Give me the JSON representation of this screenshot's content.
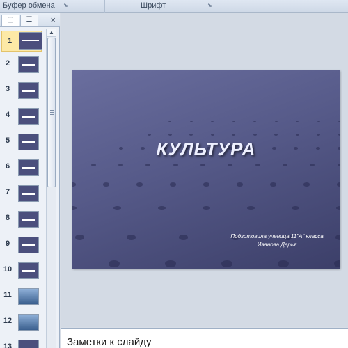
{
  "ribbon": {
    "clipboard_label": "Буфер обмена",
    "font_label": "Шрифт"
  },
  "panel": {
    "close_glyph": "×",
    "slides": [
      {
        "num": "1",
        "selected": true
      },
      {
        "num": "2"
      },
      {
        "num": "3"
      },
      {
        "num": "4"
      },
      {
        "num": "5"
      },
      {
        "num": "6"
      },
      {
        "num": "7"
      },
      {
        "num": "8"
      },
      {
        "num": "9"
      },
      {
        "num": "10"
      },
      {
        "num": "11"
      },
      {
        "num": "12"
      },
      {
        "num": "13"
      }
    ]
  },
  "slide": {
    "title": "КУЛЬТУРА",
    "subtitle_line1": "Подготовила  ученица  11\"А\"  класса",
    "subtitle_line2": "Иванова Дарья"
  },
  "notes": {
    "placeholder": "Заметки к слайду"
  }
}
